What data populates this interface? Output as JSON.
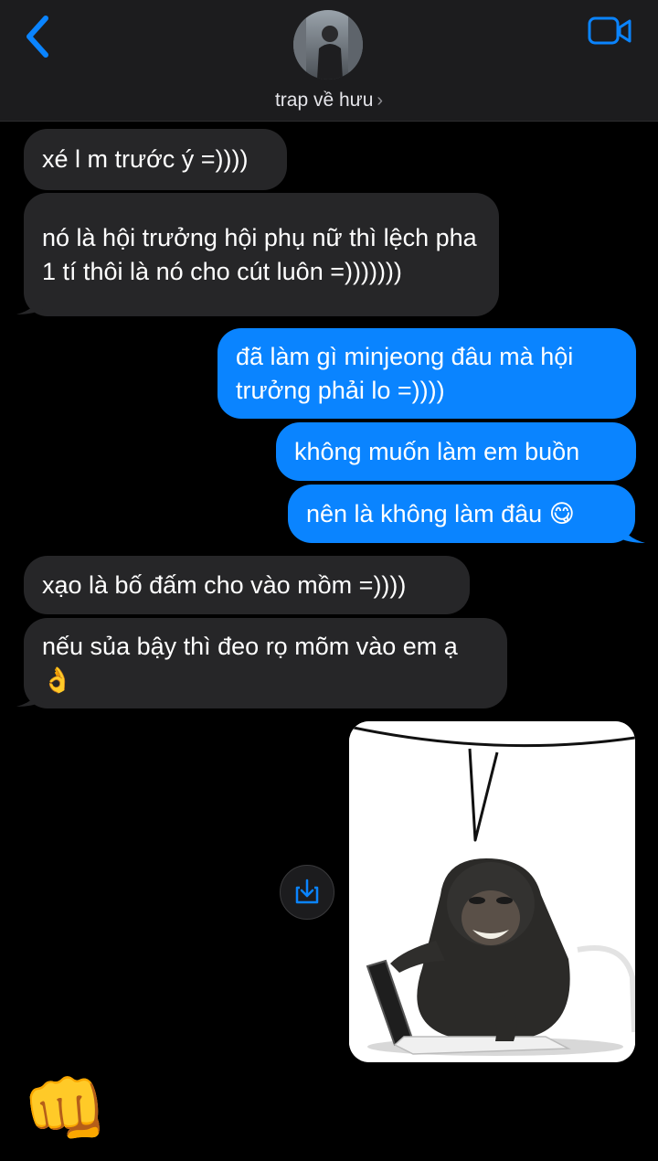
{
  "header": {
    "contact_name": "trap về hưu",
    "chevron": "›",
    "back_icon": "chevron-left-icon",
    "video_icon": "video-camera-icon",
    "accent": "#0a84ff"
  },
  "messages": [
    {
      "from": "them",
      "text": "xé l m trước ý =))))"
    },
    {
      "from": "them",
      "text": "nó là hội trưởng hội phụ nữ thì lệch pha 1 tí thôi là nó cho cút luôn =)))))))"
    },
    {
      "from": "me",
      "text": "đã làm gì minjeong đâu mà hội trưởng phải lo =))))"
    },
    {
      "from": "me",
      "text": "không muốn làm em buồn"
    },
    {
      "from": "me",
      "text": "nên là không làm đâu 😋"
    },
    {
      "from": "them",
      "text": "xạo là bố đấm cho vào mồm =))))"
    },
    {
      "from": "them",
      "text": "nếu sủa bậy thì đeo rọ mõm vào em ạ 👌"
    },
    {
      "from": "me",
      "type": "image",
      "description_icon": "image-attachment"
    },
    {
      "from": "them",
      "text": "👊"
    }
  ],
  "colors": {
    "received_bubble": "#262628",
    "sent_bubble": "#0a84ff",
    "background": "#000000",
    "header_bg": "#1c1c1e"
  }
}
